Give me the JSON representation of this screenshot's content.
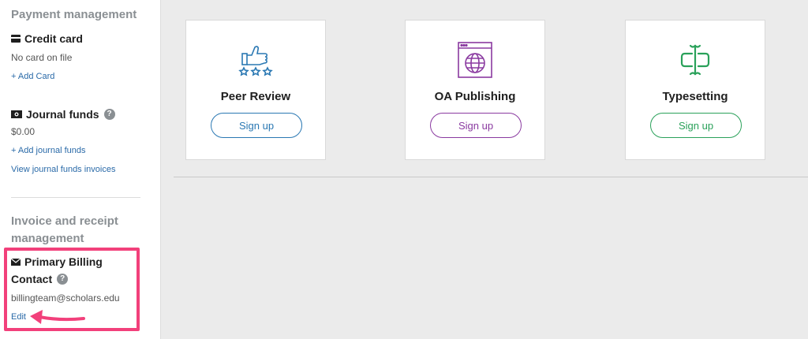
{
  "sidebar": {
    "payment_title": "Payment management",
    "credit_card": {
      "title": "Credit card",
      "status": "No card on file",
      "add_link": "+ Add Card"
    },
    "journal_funds": {
      "title": "Journal funds",
      "amount": "$0.00",
      "add_link": "+ Add journal funds",
      "invoices_link": "View journal funds invoices"
    },
    "invoice_title_line1": "Invoice and receipt",
    "invoice_title_line2": "management",
    "billing_contact": {
      "title_line1": "Primary Billing",
      "title_line2": "Contact",
      "email": "billingteam@scholars.edu",
      "edit_link": "Edit"
    }
  },
  "services": [
    {
      "name": "Peer Review",
      "button": "Sign up",
      "color": "#2a78b3",
      "icon": "thumbs-up-stars-icon"
    },
    {
      "name": "OA Publishing",
      "button": "Sign up",
      "color": "#8a3aa0",
      "icon": "globe-browser-icon"
    },
    {
      "name": "Typesetting",
      "button": "Sign up",
      "color": "#2aa15a",
      "icon": "typesetting-icon"
    }
  ],
  "colors": {
    "highlight": "#f2407b",
    "link": "#2a6aa8"
  }
}
